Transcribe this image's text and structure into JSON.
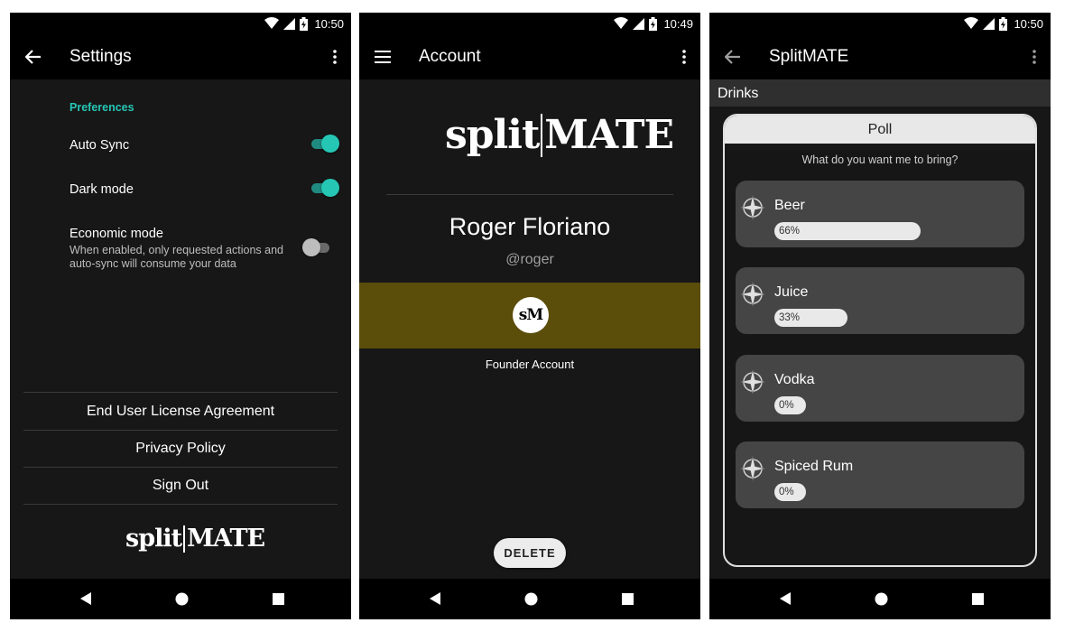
{
  "settings_screen": {
    "status_time": "10:50",
    "title": "Settings",
    "preferences_header": "Preferences",
    "auto_sync": {
      "label": "Auto Sync",
      "enabled": true
    },
    "dark_mode": {
      "label": "Dark mode",
      "enabled": true
    },
    "economic_mode": {
      "label": "Economic mode",
      "description": "When enabled, only requested actions and auto-sync will consume your data",
      "enabled": false
    },
    "links": [
      "End User License Agreement",
      "Privacy Policy",
      "Sign Out"
    ],
    "logo": {
      "left": "split",
      "right": "MATE"
    }
  },
  "account_screen": {
    "status_time": "10:49",
    "title": "Account",
    "logo": {
      "left": "split",
      "right": "MATE"
    },
    "name": "Roger Floriano",
    "handle": "@roger",
    "badge_text": "sM",
    "badge_label": "Founder Account",
    "banner_color": "#5b4d0a",
    "delete_label": "DELETE"
  },
  "poll_screen": {
    "status_time": "10:50",
    "title": "SplitMATE",
    "section": "Drinks",
    "poll_title": "Poll",
    "question": "What do you want me to bring?",
    "options": [
      {
        "label": "Beer",
        "percent_text": "66%",
        "percent": 66
      },
      {
        "label": "Juice",
        "percent_text": "33%",
        "percent": 33
      },
      {
        "label": "Vodka",
        "percent_text": "0%",
        "percent": 0
      },
      {
        "label": "Spiced Rum",
        "percent_text": "0%",
        "percent": 0
      }
    ]
  },
  "icons": {
    "status": [
      "wifi-icon",
      "signal-icon",
      "battery-charging-icon"
    ],
    "nav": [
      "nav-back-icon",
      "nav-home-icon",
      "nav-recents-icon"
    ],
    "option": "compass-star-icon"
  },
  "colors": {
    "accent": "#26c6b5",
    "background": "#171717",
    "bar": "#000000"
  }
}
